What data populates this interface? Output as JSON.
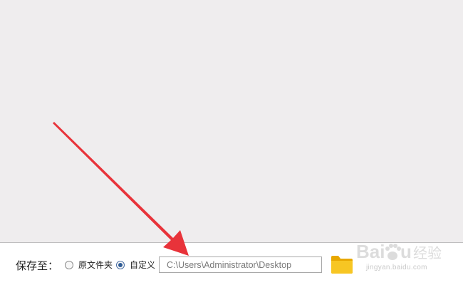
{
  "save_to": {
    "label": "保存至：",
    "options": [
      {
        "label": "原文件夹",
        "selected": false
      },
      {
        "label": "自定义",
        "selected": true
      }
    ],
    "path_value": "C:\\Users\\Administrator\\Desktop"
  },
  "icons": {
    "folder": "folder-icon"
  },
  "colors": {
    "annotation_arrow": "#e8333a",
    "folder": "#f5c21b",
    "radio_selected": "#2e5b95"
  },
  "watermark": {
    "logo_text": "Baidu经验",
    "url": "jingyan.baidu.com"
  }
}
